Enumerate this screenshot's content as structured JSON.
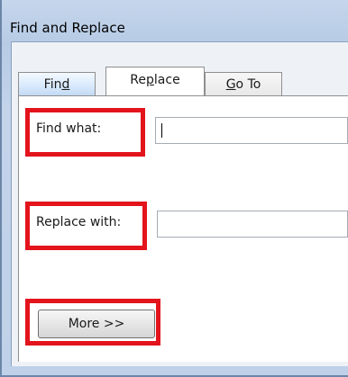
{
  "window": {
    "title": "Find and Replace"
  },
  "tabs": [
    {
      "label": "Find",
      "mnemonic": "d",
      "active": false
    },
    {
      "label": "Replace",
      "mnemonic": "p",
      "active": true
    },
    {
      "label": "Go To",
      "mnemonic": "G",
      "active": false
    }
  ],
  "find": {
    "label": "Find what:",
    "value": ""
  },
  "replace": {
    "label": "Replace with:",
    "value": ""
  },
  "buttons": {
    "more": "More >>"
  },
  "colors": {
    "highlight": "#e3141c",
    "title_bar": "#c5d6ec"
  }
}
